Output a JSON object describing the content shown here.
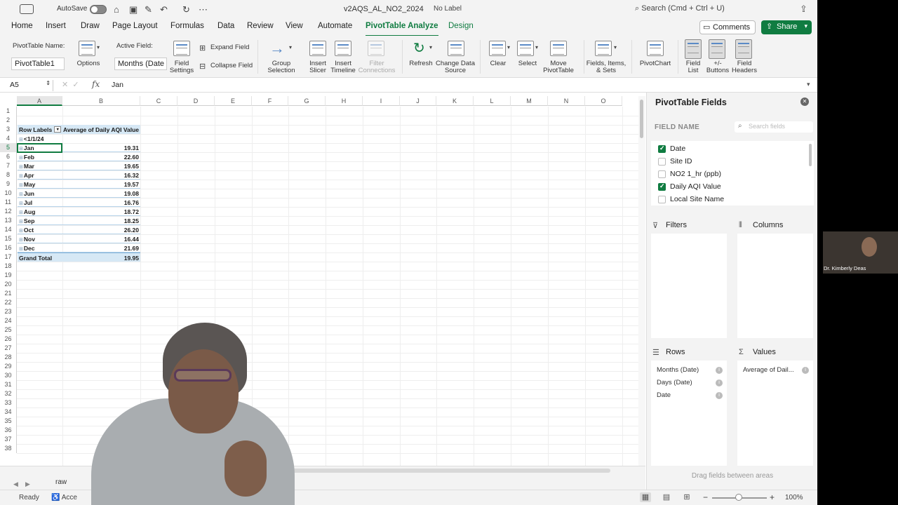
{
  "titlebar": {
    "autosave_label": "AutoSave",
    "document_title": "v2AQS_AL_NO2_2024",
    "sensitivity_label": "No Label",
    "search_placeholder": "Search (Cmd + Ctrl + U)"
  },
  "ribbon_tabs": [
    "Home",
    "Insert",
    "Draw",
    "Page Layout",
    "Formulas",
    "Data",
    "Review",
    "View",
    "Automate",
    "PivotTable Analyze",
    "Design"
  ],
  "active_tab": "PivotTable Analyze",
  "header_buttons": {
    "comments": "Comments",
    "share": "Share"
  },
  "ribbon": {
    "pivot_name_label": "PivotTable Name:",
    "pivot_name_value": "PivotTable1",
    "options": "Options",
    "active_field_label": "Active Field:",
    "active_field_value": "Months (Date",
    "field_settings": "Field Settings",
    "expand_field": "Expand Field",
    "collapse_field": "Collapse Field",
    "group_selection": "Group Selection",
    "insert_slicer": "Insert Slicer",
    "insert_timeline": "Insert Timeline",
    "filter_connections": "Filter Connections",
    "refresh": "Refresh",
    "change_data_source": "Change Data Source",
    "clear": "Clear",
    "select": "Select",
    "move_pivottable": "Move PivotTable",
    "fields_items_sets": "Fields, Items, & Sets",
    "pivotchart": "PivotChart",
    "field_list": "Field List",
    "buttons": "+/- Buttons",
    "field_headers": "Field Headers"
  },
  "formula_bar": {
    "cell_ref": "A5",
    "fx": "fx",
    "value": "Jan"
  },
  "columns": [
    "A",
    "B",
    "C",
    "D",
    "E",
    "F",
    "G",
    "H",
    "I",
    "J",
    "K",
    "L",
    "M",
    "N",
    "O"
  ],
  "rows": [
    "1",
    "2",
    "3",
    "4",
    "5",
    "6",
    "7",
    "8",
    "9",
    "10",
    "11",
    "12",
    "13",
    "14",
    "15",
    "16",
    "17",
    "18",
    "19",
    "20",
    "21",
    "22",
    "23",
    "24",
    "25",
    "26",
    "27",
    "28",
    "29",
    "30",
    "31",
    "32",
    "33",
    "34",
    "35",
    "36",
    "37",
    "38"
  ],
  "pivot": {
    "row_labels_header": "Row Labels",
    "value_header": "Average of Daily AQI Value",
    "first_label": "<1/1/24",
    "months": [
      {
        "label": "Jan",
        "value": "19.31"
      },
      {
        "label": "Feb",
        "value": "22.60"
      },
      {
        "label": "Mar",
        "value": "19.65"
      },
      {
        "label": "Apr",
        "value": "16.32"
      },
      {
        "label": "May",
        "value": "19.57"
      },
      {
        "label": "Jun",
        "value": "19.08"
      },
      {
        "label": "Jul",
        "value": "16.76"
      },
      {
        "label": "Aug",
        "value": "18.72"
      },
      {
        "label": "Sep",
        "value": "18.25"
      },
      {
        "label": "Oct",
        "value": "26.20"
      },
      {
        "label": "Nov",
        "value": "16.44"
      },
      {
        "label": "Dec",
        "value": "21.69"
      }
    ],
    "grand_total_label": "Grand Total",
    "grand_total_value": "19.95"
  },
  "sheet_tab": "raw",
  "status": {
    "ready": "Ready",
    "accessibility": "Acce",
    "zoom": "100%"
  },
  "pivot_panel": {
    "title": "PivotTable Fields",
    "field_name_label": "FIELD NAME",
    "search_placeholder": "Search fields",
    "fields": [
      {
        "name": "Date",
        "checked": true
      },
      {
        "name": "Site ID",
        "checked": false
      },
      {
        "name": "NO2 1_hr (ppb)",
        "checked": false
      },
      {
        "name": "Daily AQI Value",
        "checked": true
      },
      {
        "name": "Local Site Name",
        "checked": false
      }
    ],
    "filters_label": "Filters",
    "columns_label": "Columns",
    "rows_label": "Rows",
    "values_label": "Values",
    "rows_items": [
      "Months (Date)",
      "Days (Date)",
      "Date"
    ],
    "values_items": [
      "Average of Dail..."
    ],
    "drag_hint": "Drag fields between areas"
  },
  "video_thumbnail": {
    "name": "Dr. Kimberly Deas"
  },
  "colors": {
    "accent": "#107c41",
    "pivot_header": "#d6e8f5"
  }
}
